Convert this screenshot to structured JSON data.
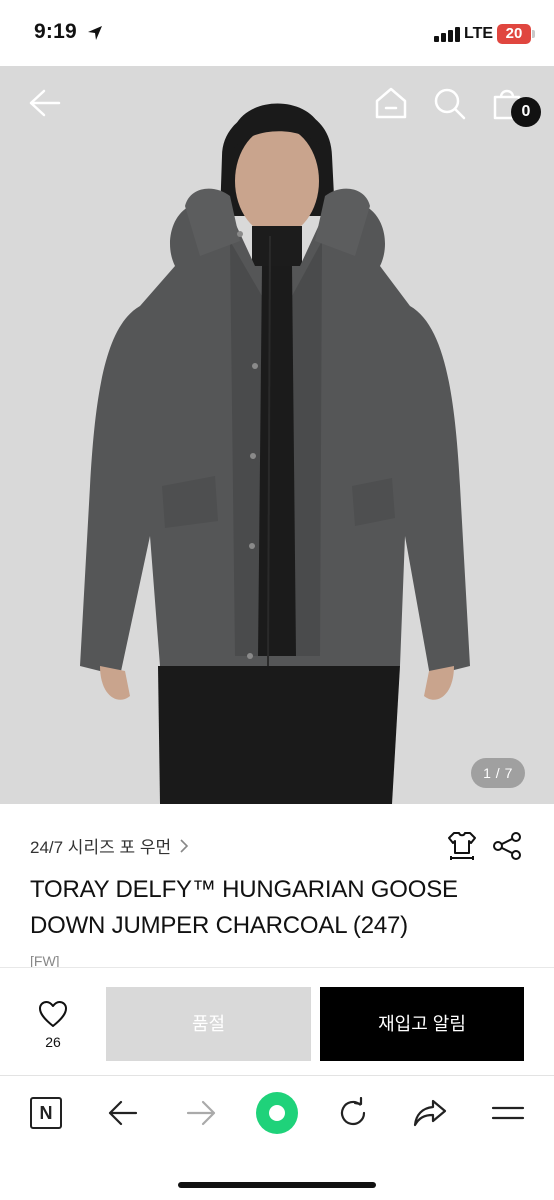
{
  "status_bar": {
    "time": "9:19",
    "network": "LTE",
    "battery": "20"
  },
  "header": {
    "cart_count": "0",
    "icons": [
      "back-arrow-icon",
      "home-icon",
      "search-icon",
      "shopping-bag-icon"
    ]
  },
  "gallery": {
    "counter": "1 / 7"
  },
  "product": {
    "series": "24/7 시리즈 포 우먼",
    "title": "TORAY DELFY™ HUNGARIAN GOOSE DOWN JUMPER CHARCOAL (247)",
    "season_tag": "[FW]"
  },
  "purchase": {
    "wish_count": "26",
    "soldout_label": "품절",
    "restock_label": "재입고 알림"
  },
  "browser_toolbar": {
    "naver_label": "N",
    "icons": [
      "naver-icon",
      "back-icon",
      "forward-icon",
      "green-dot-icon",
      "refresh-icon",
      "share-icon",
      "menu-icon"
    ]
  },
  "colors": {
    "soldout_bg": "#d9d9d9",
    "restock_bg": "#000000",
    "battery": "#e0463f",
    "green_button": "#1fd27a"
  }
}
